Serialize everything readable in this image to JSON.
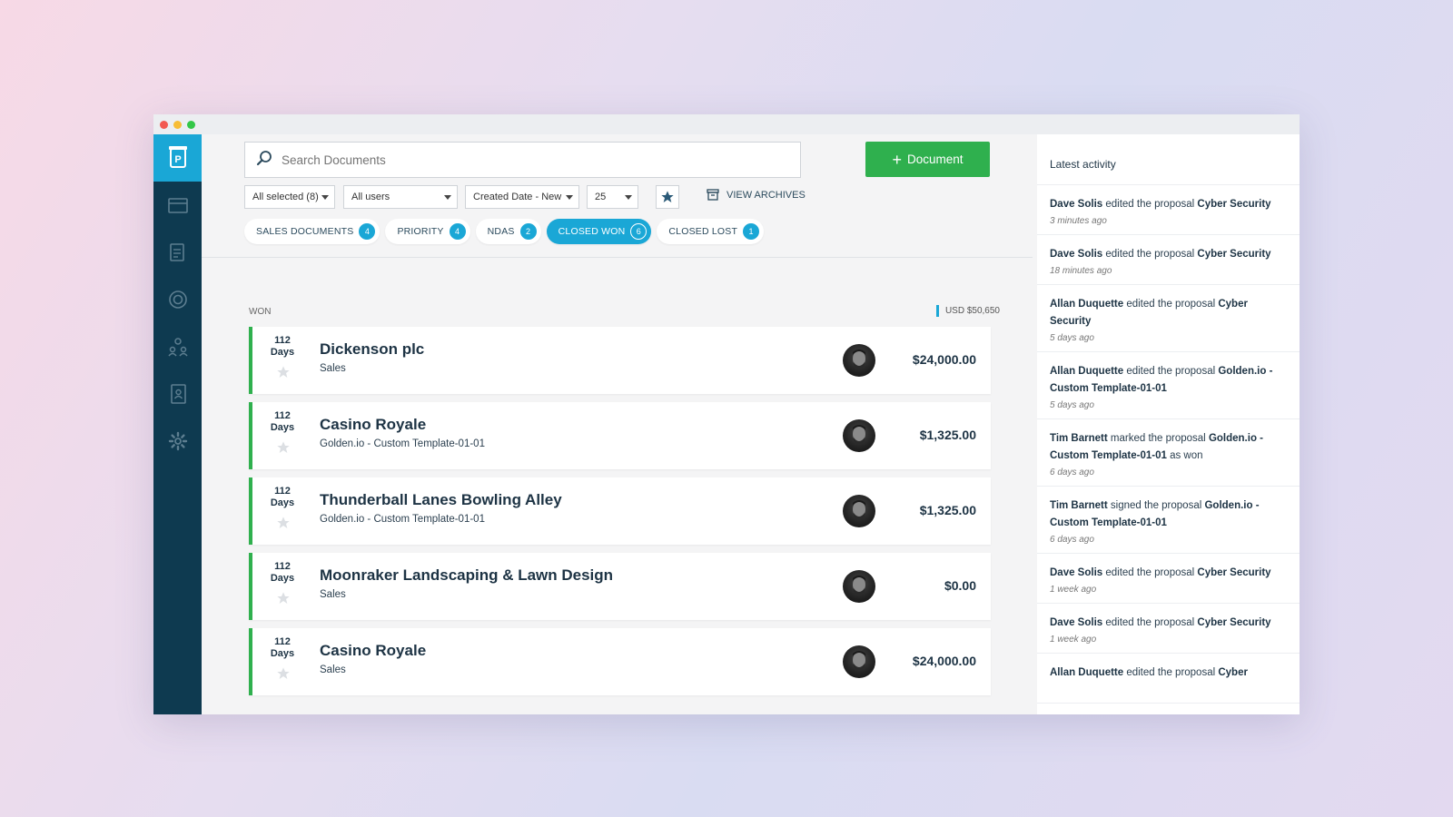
{
  "search": {
    "placeholder": "Search Documents"
  },
  "new_document": {
    "label": "Document"
  },
  "filters": {
    "status": "All selected (8)",
    "users": "All users",
    "sort": "Created Date - New",
    "per_page": "25"
  },
  "view_archives": "VIEW ARCHIVES",
  "tabs": [
    {
      "label": "SALES DOCUMENTS",
      "count": "4"
    },
    {
      "label": "PRIORITY",
      "count": "4"
    },
    {
      "label": "NDAS",
      "count": "2"
    },
    {
      "label": "CLOSED WON",
      "count": "6"
    },
    {
      "label": "CLOSED LOST",
      "count": "1"
    }
  ],
  "section": {
    "label": "WON",
    "total": "USD $50,650"
  },
  "rows": [
    {
      "days_num": "112",
      "days_unit": "Days",
      "title": "Dickenson plc",
      "subtitle": "Sales",
      "amount": "$24,000.00"
    },
    {
      "days_num": "112",
      "days_unit": "Days",
      "title": "Casino Royale",
      "subtitle": "Golden.io - Custom Template-01-01",
      "amount": "$1,325.00"
    },
    {
      "days_num": "112",
      "days_unit": "Days",
      "title": "Thunderball Lanes Bowling Alley",
      "subtitle": "Golden.io - Custom Template-01-01",
      "amount": "$1,325.00"
    },
    {
      "days_num": "112",
      "days_unit": "Days",
      "title": "Moonraker Landscaping & Lawn Design",
      "subtitle": "Sales",
      "amount": "$0.00"
    },
    {
      "days_num": "112",
      "days_unit": "Days",
      "title": "Casino Royale",
      "subtitle": "Sales",
      "amount": "$24,000.00"
    }
  ],
  "activity": {
    "title": "Latest activity",
    "items": [
      {
        "user": "Dave Solis",
        "action": " edited the proposal ",
        "target": "Cyber Security",
        "suffix": "",
        "time": "3 minutes ago"
      },
      {
        "user": "Dave Solis",
        "action": " edited the proposal ",
        "target": "Cyber Security",
        "suffix": "",
        "time": "18 minutes ago"
      },
      {
        "user": "Allan Duquette",
        "action": " edited the proposal ",
        "target": "Cyber Security",
        "suffix": "",
        "time": "5 days ago"
      },
      {
        "user": "Allan Duquette",
        "action": " edited the proposal ",
        "target": "Golden.io - Custom Template-01-01",
        "suffix": "",
        "time": "5 days ago"
      },
      {
        "user": "Tim Barnett",
        "action": " marked the proposal ",
        "target": "Golden.io - Custom Template-01-01",
        "suffix": " as won",
        "time": "6 days ago"
      },
      {
        "user": "Tim Barnett",
        "action": " signed the proposal ",
        "target": "Golden.io - Custom Template-01-01",
        "suffix": "",
        "time": "6 days ago"
      },
      {
        "user": "Dave Solis",
        "action": " edited the proposal ",
        "target": "Cyber Security",
        "suffix": "",
        "time": "1 week ago"
      },
      {
        "user": "Dave Solis",
        "action": " edited the proposal ",
        "target": "Cyber Security",
        "suffix": "",
        "time": "1 week ago"
      },
      {
        "user": "Allan Duquette",
        "action": " edited the proposal ",
        "target": "Cyber",
        "suffix": "",
        "time": ""
      }
    ]
  },
  "colors": {
    "accent": "#1aa7d6",
    "success": "#2fb04e",
    "sidebar": "#0e3a50"
  },
  "icons": [
    "logo-icon",
    "inbox-icon",
    "documents-icon",
    "target-icon",
    "contacts-icon",
    "address-book-icon",
    "gear-icon",
    "search-icon",
    "star-icon",
    "archive-icon"
  ]
}
